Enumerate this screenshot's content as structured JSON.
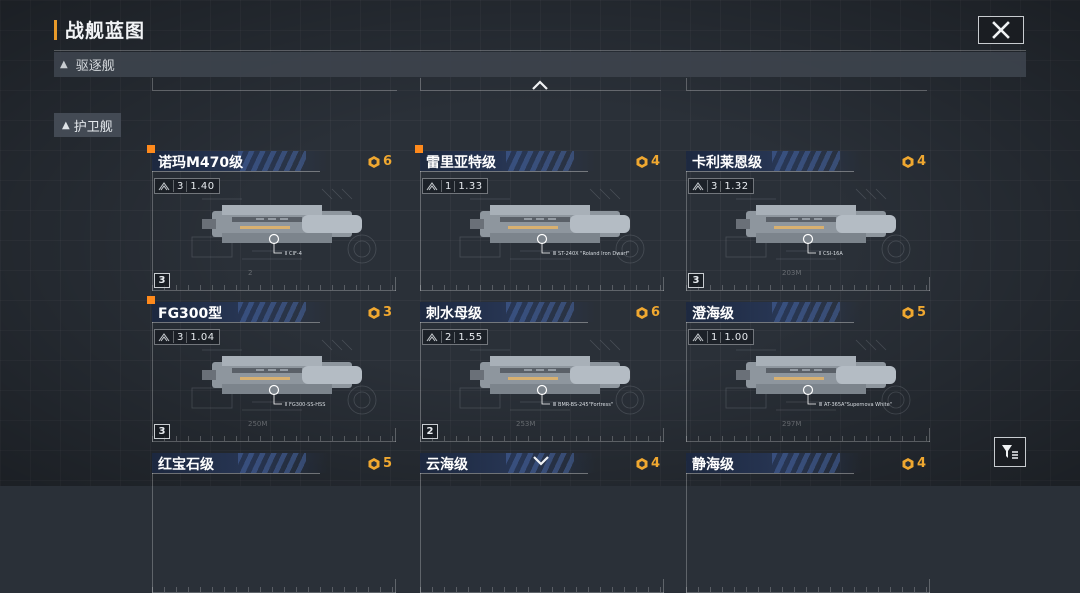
{
  "header": {
    "title": "战舰蓝图"
  },
  "category": {
    "label": "驱逐舰"
  },
  "side_filter": {
    "label": "护卫舰"
  },
  "icons": {
    "close": "close-icon",
    "scroll_up": "chevron-up-icon",
    "scroll_down": "chevron-down-icon",
    "filter": "filter-icon",
    "slot": "hex-slot-icon"
  },
  "colors": {
    "accent": "#f0a830",
    "marker": "#ff8a1c",
    "name_bar": "#28385a",
    "background": "#2a3038"
  },
  "ships": [
    {
      "name": "诺玛M470级",
      "slots": "6",
      "tier": "3",
      "value": "1.40",
      "badge": "3",
      "ship_label": "Ⅱ CIF-4",
      "length": "2",
      "new": true
    },
    {
      "name": "雷里亚特级",
      "slots": "4",
      "tier": "1",
      "value": "1.33",
      "badge": "",
      "ship_label": "Ⅲ ST-240X \"Roland Iron Dwarf\"",
      "length": "",
      "new": true
    },
    {
      "name": "卡利莱恩级",
      "slots": "4",
      "tier": "3",
      "value": "1.32",
      "badge": "3",
      "ship_label": "Ⅱ CSI-16A",
      "length": "203M",
      "new": false
    },
    {
      "name": "FG300型",
      "slots": "3",
      "tier": "3",
      "value": "1.04",
      "badge": "3",
      "ship_label": "Ⅱ FG300-SS-HSS",
      "length": "250M",
      "new": true
    },
    {
      "name": "刺水母级",
      "slots": "6",
      "tier": "2",
      "value": "1.55",
      "badge": "2",
      "ship_label": "Ⅲ BMR-BS-245\"Fortress\"",
      "length": "253M",
      "new": false
    },
    {
      "name": "澄海级",
      "slots": "5",
      "tier": "1",
      "value": "1.00",
      "badge": "",
      "ship_label": "Ⅲ AT-365A\"Supernova White\"",
      "length": "297M",
      "new": false
    },
    {
      "name": "红宝石级",
      "slots": "5",
      "tier": "",
      "value": "",
      "badge": "",
      "ship_label": "",
      "length": "",
      "new": false
    },
    {
      "name": "云海级",
      "slots": "4",
      "tier": "",
      "value": "",
      "badge": "",
      "ship_label": "",
      "length": "",
      "new": false
    },
    {
      "name": "静海级",
      "slots": "4",
      "tier": "",
      "value": "",
      "badge": "",
      "ship_label": "",
      "length": "",
      "new": false
    }
  ]
}
